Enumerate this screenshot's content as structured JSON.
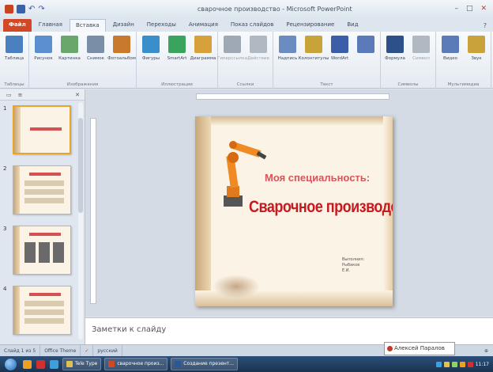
{
  "window": {
    "title": "сварочное производство - Microsoft PowerPoint"
  },
  "ribbon": {
    "tabs": [
      "Файл",
      "Главная",
      "Вставка",
      "Дизайн",
      "Переходы",
      "Анимация",
      "Показ слайдов",
      "Рецензирование",
      "Вид"
    ],
    "active_tab": "Вставка",
    "groups": [
      {
        "label": "Таблицы",
        "buttons": [
          {
            "label": "Таблица",
            "color": "#4a7fc0"
          }
        ]
      },
      {
        "label": "Изображения",
        "buttons": [
          {
            "label": "Рисунок",
            "color": "#5c8fcf"
          },
          {
            "label": "Картинка",
            "color": "#6aa76a"
          },
          {
            "label": "Снимок",
            "color": "#7a8ea8"
          },
          {
            "label": "Фотоальбом",
            "color": "#c9792d"
          }
        ]
      },
      {
        "label": "Иллюстрации",
        "buttons": [
          {
            "label": "Фигуры",
            "color": "#3a8ec9"
          },
          {
            "label": "SmartArt",
            "color": "#3aa35e"
          },
          {
            "label": "Диаграмма",
            "color": "#d6a03a"
          }
        ]
      },
      {
        "label": "Ссылки",
        "buttons": [
          {
            "label": "Гиперссылка",
            "color": "#9fa9b5",
            "dim": true
          },
          {
            "label": "Действие",
            "color": "#b0b8c2",
            "dim": true
          }
        ]
      },
      {
        "label": "Текст",
        "buttons": [
          {
            "label": "Надпись",
            "color": "#6a8cc0"
          },
          {
            "label": "Колонтитулы",
            "color": "#c8a33a"
          },
          {
            "label": "WordArt",
            "color": "#3a5fa8"
          },
          {
            "label": "",
            "color": "#5a7ab8"
          }
        ]
      },
      {
        "label": "Символы",
        "buttons": [
          {
            "label": "Формула",
            "color": "#2d4f8a"
          },
          {
            "label": "Символ",
            "color": "#b0b8c2",
            "dim": true
          }
        ]
      },
      {
        "label": "Мультимедиа",
        "buttons": [
          {
            "label": "Видео",
            "color": "#5a7ab8"
          },
          {
            "label": "Звук",
            "color": "#c9a33a"
          }
        ]
      }
    ]
  },
  "slides_pane": {
    "slide_numbers": [
      "1",
      "2",
      "3",
      "4"
    ],
    "selected_index": 0
  },
  "slide": {
    "subtitle": "Моя специальность:",
    "title": "Сварочное производство",
    "author_lines": [
      "Выполнил:",
      "Рыбаков",
      "Е.И."
    ]
  },
  "notes": {
    "placeholder": "Заметки к слайду"
  },
  "statusbar": {
    "slide_info": "Слайд 1 из 5",
    "theme": "Office Theme",
    "language": "русский",
    "popup_name": "Алексей Паралов"
  },
  "taskbar": {
    "tasks": [
      {
        "label": "Tele Туре",
        "color": "#e0c050"
      },
      {
        "label": "сварочное произ...",
        "color": "#d24726"
      },
      {
        "label": "Создание презент...",
        "color": "#2b579a"
      }
    ],
    "time": "11:17"
  }
}
